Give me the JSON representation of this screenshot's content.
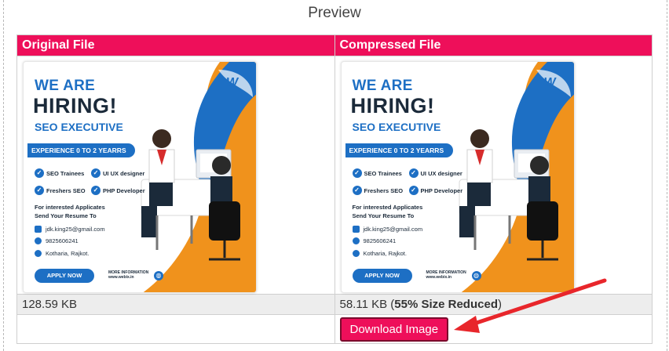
{
  "preview": {
    "title": "Preview"
  },
  "columns": [
    {
      "header": "Original File",
      "size": "128.59 KB",
      "reduction": "",
      "reduction_suffix": ""
    },
    {
      "header": "Compressed File",
      "size": "58.11 KB (",
      "reduction": "55% Size Reduced",
      "reduction_suffix": ")"
    }
  ],
  "poster": {
    "line1": "WE ARE",
    "line2": "HIRING!",
    "role": "SEO EXECUTIVE",
    "experience": "EXPERIENCE 0 TO 2 YEARRS",
    "skills": [
      "SEO Trainees",
      "UI UX designer",
      "Freshers SEO",
      "PHP Developer"
    ],
    "interest_line1": "For interested Applicates",
    "interest_line2": "Send Your Resume To",
    "email": "jdk.king25@gmail.com",
    "phone": "9825606241",
    "location": "Kotharia, Rajkot.",
    "apply": "APPLY NOW",
    "more_line1": "MORE INFORMATION",
    "more_line2": "www.webix.in",
    "logo_letter": "W",
    "colors": {
      "blue": "#1d6fc4",
      "orange": "#f0921c",
      "dark": "#1b2a3a"
    }
  },
  "actions": {
    "download_label": "Download Image"
  },
  "colors": {
    "accent": "#ee0f5a",
    "size_row_bg": "#ededed",
    "arrow": "#e8262b"
  }
}
